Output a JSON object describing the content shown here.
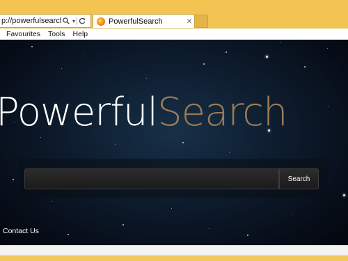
{
  "browser": {
    "address": "p://powerfulsearch....",
    "address_icons": [
      "search-icon",
      "refresh-icon"
    ],
    "tab": {
      "title": "PowerfulSearch",
      "favicon": "powerfulsearch-favicon"
    },
    "menu": [
      "Favourites",
      "Tools",
      "Help"
    ]
  },
  "page": {
    "logo_part1": "Powerful",
    "logo_part2": "Search",
    "logo_colors": {
      "white": "#ffffff",
      "gold": "#9c7a55"
    },
    "search": {
      "placeholder": "",
      "button_label": "Search"
    },
    "footer_link": "Contact Us"
  },
  "theme": {
    "chrome": "#f4c452",
    "background": "#0b1726"
  }
}
